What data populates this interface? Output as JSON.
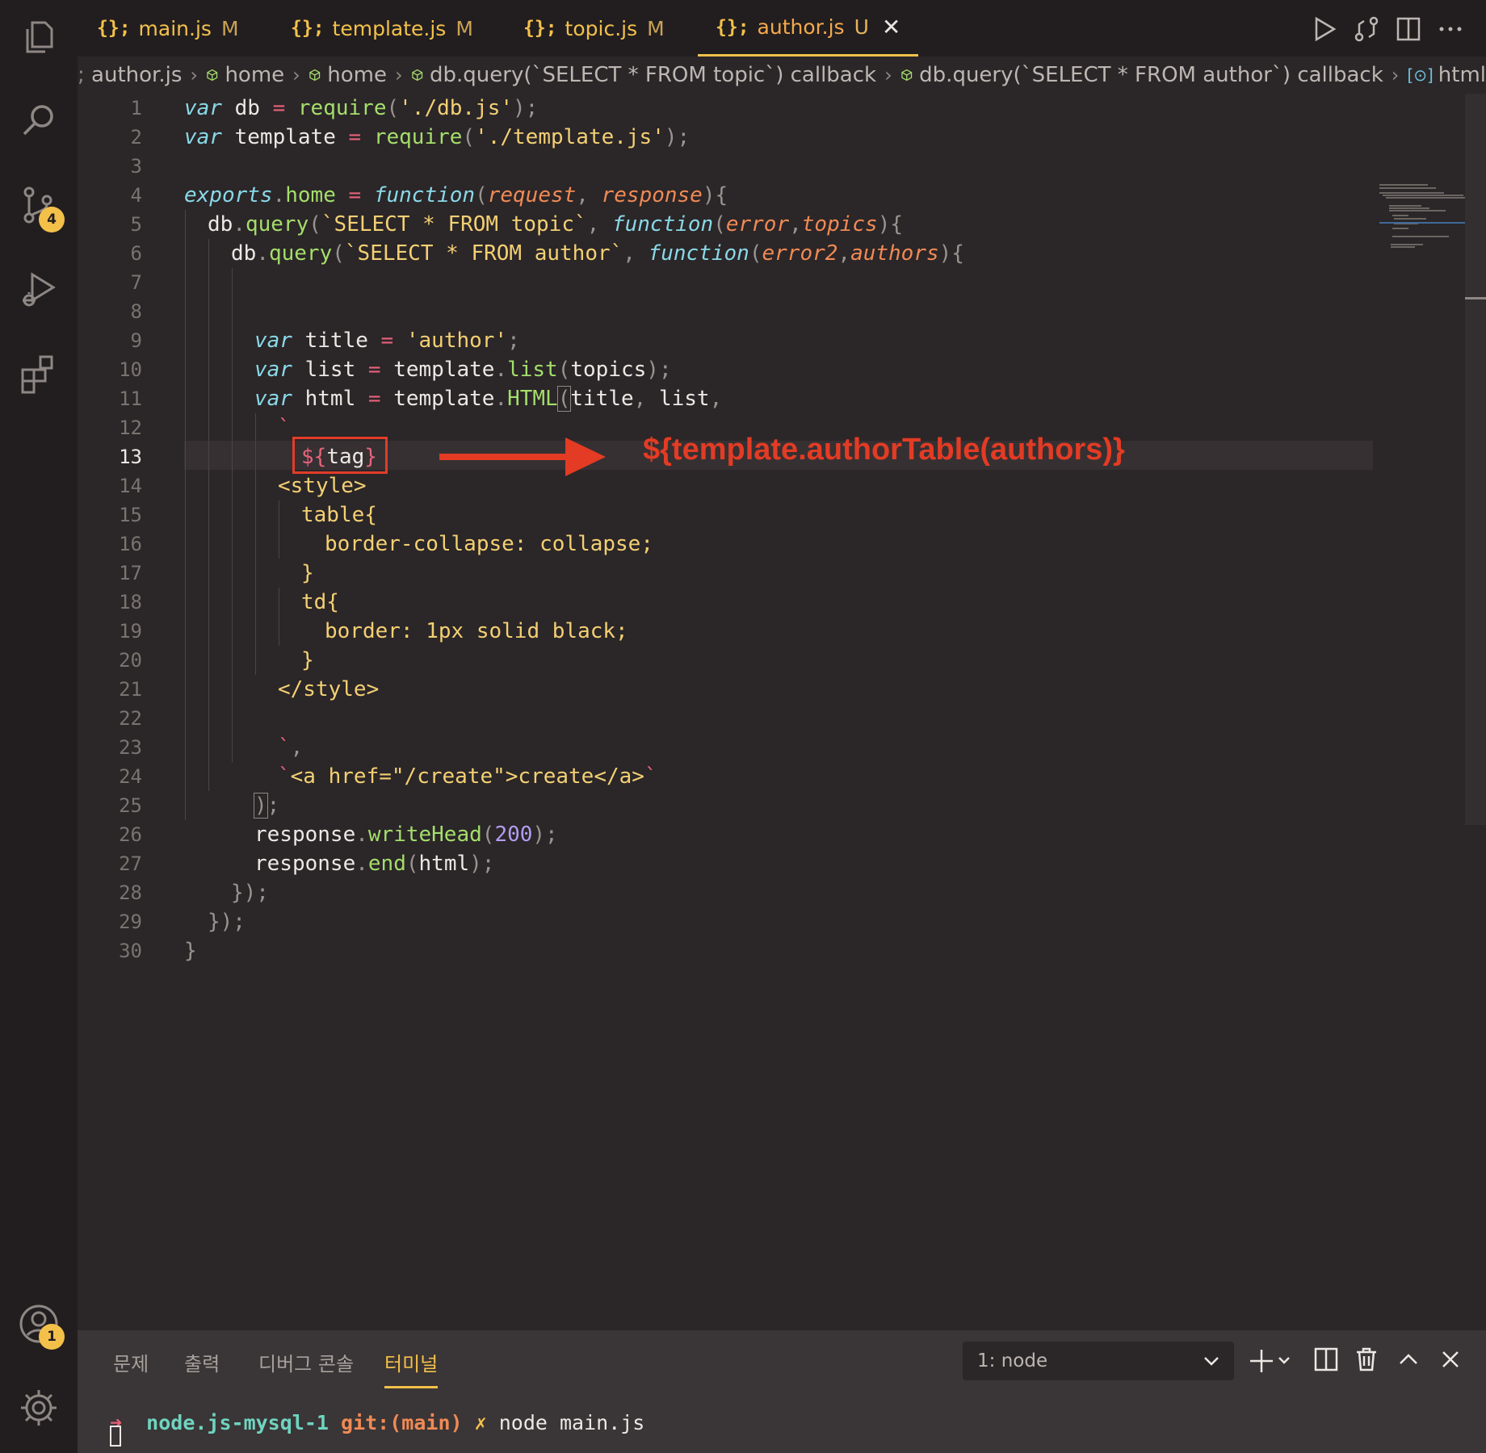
{
  "tabs": [
    {
      "icon": "{};",
      "name": "main.js",
      "status": "M"
    },
    {
      "icon": "{};",
      "name": "template.js",
      "status": "M"
    },
    {
      "icon": "{};",
      "name": "topic.js",
      "status": "M"
    },
    {
      "icon": "{};",
      "name": "author.js",
      "status": "U",
      "active": true
    }
  ],
  "breadcrumbs": {
    "file": "author.js",
    "items": [
      "home",
      "home",
      "db.query(`SELECT * FROM topic`) callback",
      "db.query(`SELECT * FROM author`) callback"
    ],
    "last": "html"
  },
  "badges": {
    "scm": "4",
    "account": "1"
  },
  "line_numbers": [
    "1",
    "2",
    "3",
    "4",
    "5",
    "6",
    "7",
    "8",
    "9",
    "10",
    "11",
    "12",
    "13",
    "14",
    "15",
    "16",
    "17",
    "18",
    "19",
    "20",
    "21",
    "22",
    "23",
    "24",
    "25",
    "26",
    "27",
    "28",
    "29",
    "30"
  ],
  "code": {
    "l1": [
      "var",
      " db ",
      "=",
      " ",
      "require",
      "(",
      "'./db.js'",
      ");"
    ],
    "l2": [
      "var",
      " template ",
      "=",
      " ",
      "require",
      "(",
      "'./template.js'",
      ");"
    ],
    "l4": [
      "exports",
      ".",
      "home",
      " = ",
      "function",
      "(",
      "request",
      ", ",
      "response",
      "){"
    ],
    "l5": [
      "db",
      ".",
      "query",
      "(",
      "`SELECT * FROM topic`",
      ", ",
      "function",
      "(",
      "error",
      ",",
      "topics",
      "){"
    ],
    "l6": [
      "db",
      ".",
      "query",
      "(",
      "`SELECT * FROM author`",
      ", ",
      "function",
      "(",
      "error2",
      ",",
      "authors",
      "){"
    ],
    "l9": [
      "var",
      " title ",
      "=",
      " ",
      "'author'",
      ";"
    ],
    "l10": [
      "var",
      " list ",
      "=",
      " template",
      ".",
      "list",
      "(",
      "topics",
      ");"
    ],
    "l11": [
      "var",
      " html ",
      "=",
      " template",
      ".",
      "HTML",
      "(",
      "title",
      ", ",
      "list",
      ","
    ],
    "l12": "`",
    "l13": [
      "${",
      "tag",
      "}"
    ],
    "l14": "<style>",
    "l15": "table{",
    "l16": "border-collapse: collapse;",
    "l17": "}",
    "l18": "td{",
    "l19": "border: 1px solid black;",
    "l20": "}",
    "l21": "</style>",
    "l23": [
      "`",
      ","
    ],
    "l24": [
      "`",
      "<a href=\"/create\">create</a>",
      "`"
    ],
    "l25": [
      ")",
      ";"
    ],
    "l26": [
      "response",
      ".",
      "writeHead",
      "(",
      "200",
      ");"
    ],
    "l27": [
      "response",
      ".",
      "end",
      "(",
      "html",
      ");"
    ],
    "l28": "});",
    "l29": "});",
    "l30": "}"
  },
  "annotation": "${template.authorTable(authors)}",
  "panel": {
    "tabs": [
      "문제",
      "출력",
      "디버그 콘솔",
      "터미널"
    ],
    "active_tab": "터미널",
    "terminal_select": "1: node",
    "prompt": {
      "arrow": "➜",
      "dir": "node.js-mysql-1",
      "git": "git:",
      "branch": "(main)",
      "x": "✗",
      "cmd": "node main.js"
    }
  },
  "colors": {
    "accent": "#f3c14a",
    "annotation": "#e33b24",
    "background": "#2b2628"
  }
}
